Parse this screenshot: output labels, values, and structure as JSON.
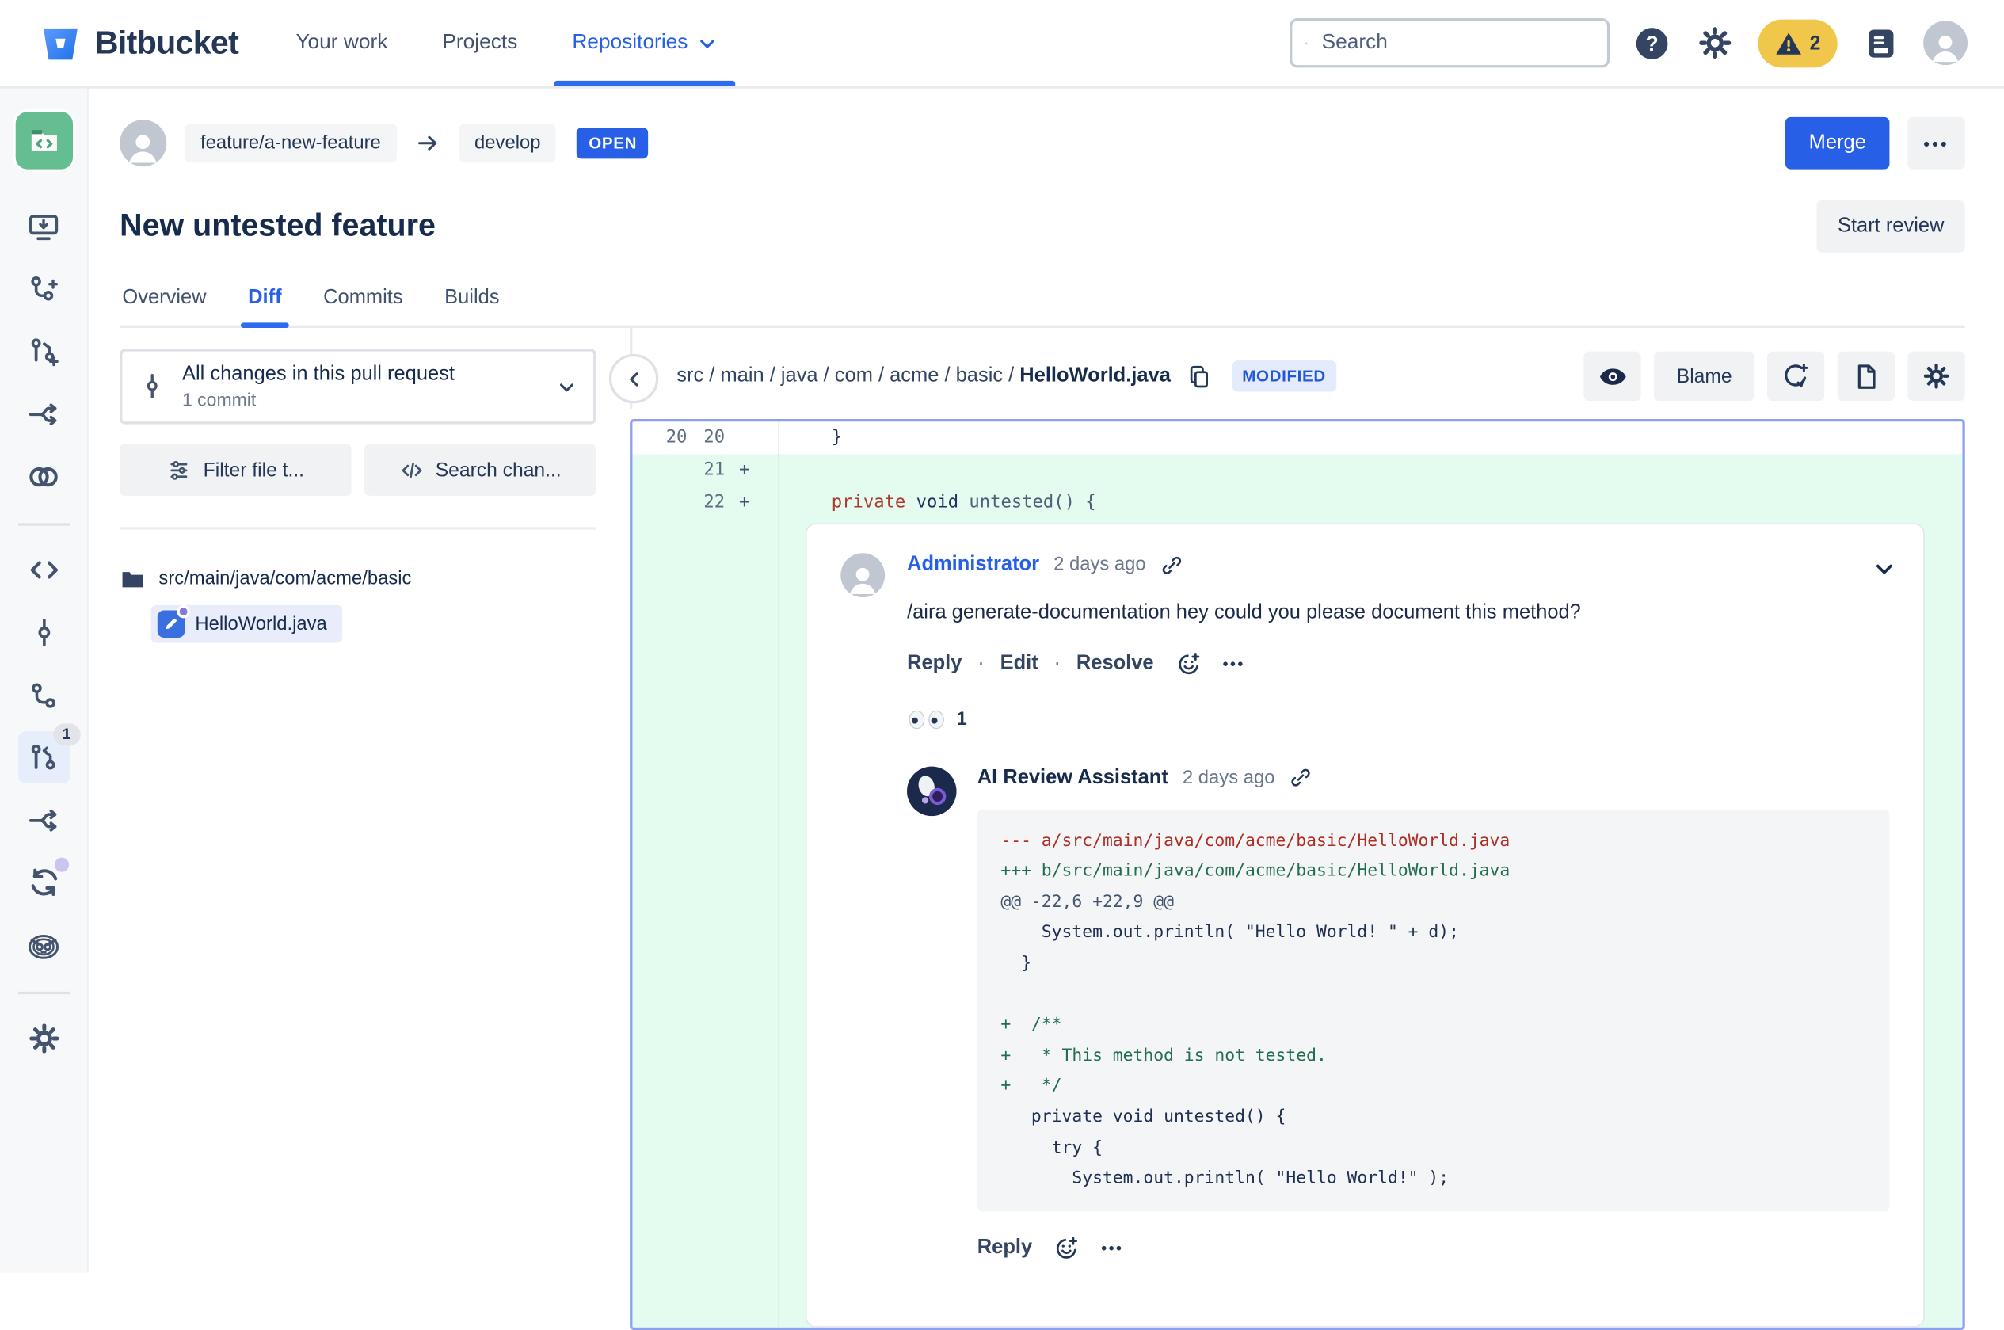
{
  "topnav": {
    "brand": "Bitbucket",
    "items": [
      {
        "label": "Your work"
      },
      {
        "label": "Projects"
      },
      {
        "label": "Repositories"
      }
    ],
    "search_placeholder": "Search",
    "warning_count": "2"
  },
  "rail": {
    "pr_badge": "1"
  },
  "pr": {
    "source_branch": "feature/a-new-feature",
    "target_branch": "develop",
    "status": "OPEN",
    "title": "New untested feature",
    "merge_label": "Merge",
    "more_label": "•••",
    "start_review_label": "Start review",
    "tabs": [
      {
        "label": "Overview"
      },
      {
        "label": "Diff"
      },
      {
        "label": "Commits"
      },
      {
        "label": "Builds"
      }
    ]
  },
  "left_panel": {
    "scope_title": "All changes in this pull request",
    "scope_subtitle": "1 commit",
    "filter_button": "Filter file t...",
    "search_button": "Search chan...",
    "folder": "src/main/java/com/acme/basic",
    "file": "HelloWorld.java"
  },
  "diff_header": {
    "path_prefix": "src / main / java / com / acme / basic / ",
    "file_name": "HelloWorld.java",
    "status_badge": "MODIFIED",
    "blame_label": "Blame"
  },
  "diff": {
    "rows": [
      {
        "old": "20",
        "new": "20",
        "marker": "",
        "code": "}"
      },
      {
        "old": "",
        "new": "21",
        "marker": "+",
        "code": ""
      },
      {
        "old": "",
        "new": "22",
        "marker": "+"
      }
    ],
    "line22_tokens": [
      {
        "t": "private",
        "kind": "kw"
      },
      {
        "t": " ",
        "kind": "plain"
      },
      {
        "t": "void",
        "kind": "type"
      },
      {
        "t": " untested() {",
        "kind": "plain"
      }
    ]
  },
  "comment": {
    "author": "Administrator",
    "time": "2 days ago",
    "body": "/aira generate-documentation hey could you please document this method?",
    "reply_label": "Reply",
    "edit_label": "Edit",
    "resolve_label": "Resolve",
    "separator": "·",
    "more_label": "•••",
    "reaction": {
      "emoji": "eyes",
      "count": "1"
    }
  },
  "ai_reply": {
    "author": "AI Review Assistant",
    "time": "2 days ago",
    "reply_label": "Reply",
    "more_label": "•••",
    "code_lines": [
      {
        "text": "--- a/src/main/java/com/acme/basic/HelloWorld.java",
        "kind": "del"
      },
      {
        "text": "+++ b/src/main/java/com/acme/basic/HelloWorld.java",
        "kind": "add"
      },
      {
        "text": "@@ -22,6 +22,9 @@",
        "kind": "hunk"
      },
      {
        "text": "    System.out.println( \"Hello World! \" + d);",
        "kind": "ctx"
      },
      {
        "text": "  }",
        "kind": "ctx"
      },
      {
        "text": "",
        "kind": "ctx"
      },
      {
        "text": "+  /**",
        "kind": "add"
      },
      {
        "text": "+   * This method is not tested.",
        "kind": "add"
      },
      {
        "text": "+   */",
        "kind": "add"
      },
      {
        "text": "   private void untested() {",
        "kind": "ctx"
      },
      {
        "text": "     try {",
        "kind": "ctx"
      },
      {
        "text": "       System.out.println( \"Hello World!\" );",
        "kind": "ctx"
      }
    ]
  },
  "colors": {
    "brand_blue": "#2760E6",
    "open_badge_bg": "#2760E6",
    "modified_badge_bg": "#E3EBFC",
    "modified_badge_text": "#2458D6",
    "added_line_bg": "#E3FCEF",
    "file_border": "#8C9FF0",
    "warning_pill_bg": "#F0C64B",
    "repo_avatar_green": "#65BE92",
    "code_removed": "#AE2E24",
    "code_added": "#216E4E"
  }
}
